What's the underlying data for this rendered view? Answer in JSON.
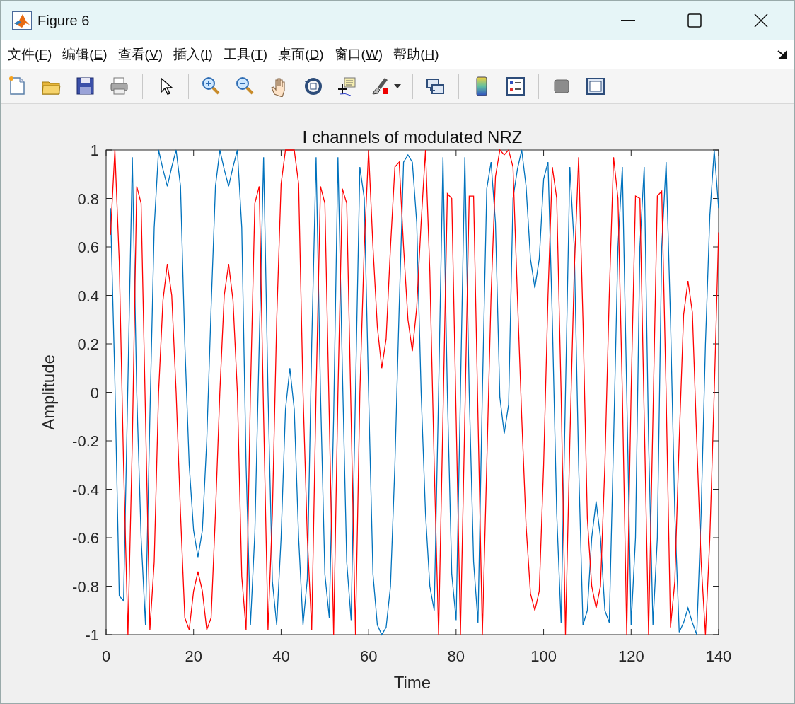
{
  "window": {
    "title": "Figure 6"
  },
  "menu": [
    "文件(F)",
    "编辑(E)",
    "查看(V)",
    "插入(I)",
    "工具(T)",
    "桌面(D)",
    "窗口(W)",
    "帮助(H)"
  ],
  "figure": {
    "chart_data": {
      "type": "line",
      "title": "I channels of modulated NRZ",
      "xlabel": "Time",
      "ylabel": "Amplitude",
      "xlim": [
        0,
        140
      ],
      "ylim": [
        -1,
        1
      ],
      "xticks": [
        0,
        20,
        40,
        60,
        80,
        100,
        120,
        140
      ],
      "yticks": [
        -1,
        -0.8,
        -0.6,
        -0.4,
        -0.2,
        0,
        0.2,
        0.4,
        0.6,
        0.8,
        1
      ],
      "x": [
        1,
        2,
        3,
        4,
        5,
        6,
        7,
        8,
        9,
        10,
        11,
        12,
        13,
        14,
        15,
        16,
        17,
        18,
        19,
        20,
        21,
        22,
        23,
        24,
        25,
        26,
        27,
        28,
        29,
        30,
        31,
        32,
        33,
        34,
        35,
        36,
        37,
        38,
        39,
        40,
        41,
        42,
        43,
        44,
        45,
        46,
        47,
        48,
        49,
        50,
        51,
        52,
        53,
        54,
        55,
        56,
        57,
        58,
        59,
        60,
        61,
        62,
        63,
        64,
        65,
        66,
        67,
        68,
        69,
        70,
        71,
        72,
        73,
        74,
        75,
        76,
        77,
        78,
        79,
        80,
        81,
        82,
        83,
        84,
        85,
        86,
        87,
        88,
        89,
        90,
        91,
        92,
        93,
        94,
        95,
        96,
        97,
        98,
        99,
        100,
        101,
        102,
        103,
        104,
        105,
        106,
        107,
        108,
        109,
        110,
        111,
        112,
        113,
        114,
        115,
        116,
        117,
        118,
        119,
        120,
        121,
        122,
        123,
        124,
        125,
        126,
        127,
        128,
        129,
        130,
        131,
        132,
        133,
        134,
        135,
        136,
        137,
        138,
        139,
        140
      ],
      "series": [
        {
          "color": "#0072bd",
          "values": [
            0.76,
            0.05,
            -0.84,
            -0.86,
            0.05,
            0.97,
            0.0,
            -0.6,
            -0.96,
            -0.1,
            0.68,
            1.0,
            0.92,
            0.85,
            0.93,
            1.0,
            0.85,
            0.2,
            -0.3,
            -0.57,
            -0.68,
            -0.57,
            -0.2,
            0.35,
            0.85,
            1.0,
            0.92,
            0.85,
            0.93,
            1.0,
            0.68,
            -0.3,
            -0.96,
            -0.58,
            0.2,
            0.97,
            0.0,
            -0.78,
            -0.96,
            -0.6,
            -0.07,
            0.1,
            -0.07,
            -0.6,
            -0.96,
            -0.77,
            0.2,
            0.97,
            0.0,
            -0.75,
            -0.93,
            -0.1,
            0.97,
            0.1,
            -0.7,
            -0.94,
            0.0,
            0.93,
            0.8,
            0.0,
            -0.75,
            -0.96,
            -1.0,
            -0.97,
            -0.8,
            -0.3,
            0.35,
            0.95,
            0.98,
            0.95,
            0.7,
            0.0,
            -0.5,
            -0.8,
            -0.9,
            0.0,
            0.97,
            0.0,
            -0.75,
            -0.94,
            0.0,
            0.97,
            0.0,
            -0.7,
            -0.95,
            0.0,
            0.84,
            0.95,
            0.7,
            -0.02,
            -0.17,
            -0.05,
            0.8,
            0.92,
            1.0,
            0.85,
            0.55,
            0.43,
            0.55,
            0.88,
            0.95,
            0.3,
            -0.5,
            -0.95,
            0.0,
            0.93,
            0.6,
            -0.3,
            -0.96,
            -0.9,
            -0.6,
            -0.45,
            -0.6,
            -0.9,
            -0.95,
            -0.2,
            0.6,
            0.93,
            0.0,
            -0.96,
            -0.6,
            0.6,
            0.93,
            -0.2,
            -0.96,
            -0.6,
            0.6,
            0.95,
            0.3,
            -0.5,
            -0.99,
            -0.95,
            -0.89,
            -0.95,
            -1.0,
            -0.5,
            0.2,
            0.73,
            1.0,
            0.76
          ]
        },
        {
          "color": "#ff0000",
          "values": [
            0.65,
            1.0,
            0.54,
            -0.3,
            -1.0,
            -0.2,
            0.85,
            0.78,
            -0.1,
            -0.98,
            -0.7,
            0.0,
            0.38,
            0.53,
            0.4,
            0.0,
            -0.5,
            -0.93,
            -0.98,
            -0.82,
            -0.74,
            -0.82,
            -0.98,
            -0.93,
            -0.5,
            0.0,
            0.4,
            0.53,
            0.38,
            0.0,
            -0.76,
            -0.98,
            0.0,
            0.78,
            0.85,
            -0.1,
            -0.98,
            -0.5,
            0.3,
            0.86,
            1.0,
            1.0,
            1.0,
            0.86,
            0.0,
            -0.6,
            -0.98,
            0.0,
            0.85,
            0.78,
            -0.1,
            -1.0,
            0.0,
            0.84,
            0.78,
            -0.1,
            -1.0,
            0.0,
            0.6,
            1.0,
            0.6,
            0.27,
            0.1,
            0.22,
            0.6,
            0.93,
            0.95,
            0.6,
            0.3,
            0.17,
            0.35,
            0.7,
            1.0,
            0.5,
            -0.3,
            -1.0,
            -0.1,
            0.82,
            0.8,
            -0.1,
            -1.0,
            -0.1,
            0.81,
            0.81,
            -0.1,
            -1.0,
            -0.3,
            0.4,
            0.89,
            1.0,
            0.98,
            1.0,
            0.93,
            0.4,
            -0.1,
            -0.55,
            -0.83,
            -0.9,
            -0.82,
            -0.3,
            0.4,
            0.93,
            0.8,
            0.0,
            -1.0,
            -0.2,
            0.5,
            0.97,
            0.3,
            -0.52,
            -0.8,
            -0.89,
            -0.8,
            -0.3,
            0.4,
            0.97,
            0.8,
            0.0,
            -1.0,
            0.0,
            0.81,
            0.8,
            -0.1,
            -1.0,
            -0.1,
            0.81,
            0.83,
            0.0,
            -0.97,
            -0.78,
            -0.2,
            0.32,
            0.46,
            0.33,
            -0.2,
            -0.7,
            -1.0,
            -0.6,
            0.0,
            0.66
          ]
        }
      ]
    }
  }
}
